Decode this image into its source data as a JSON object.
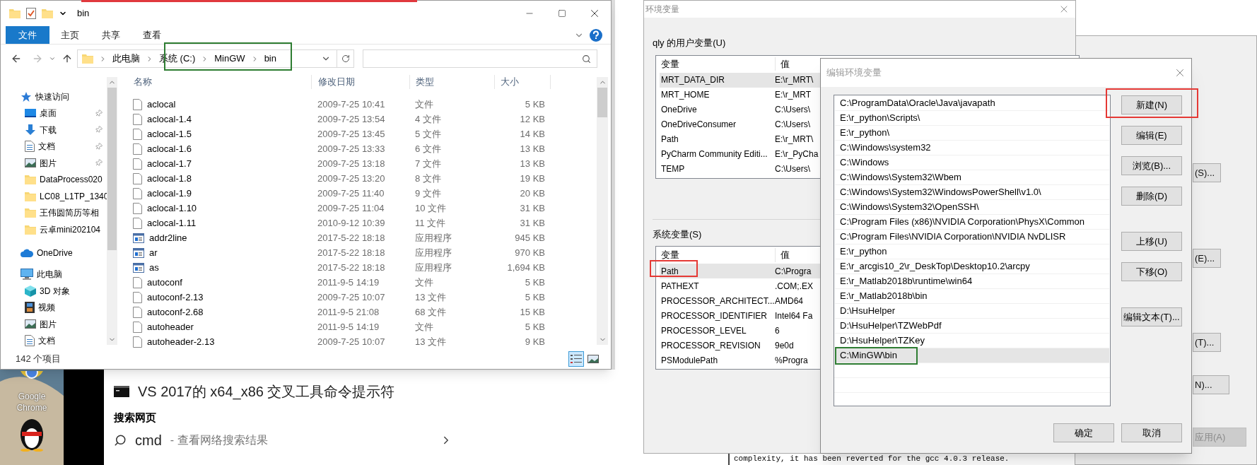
{
  "explorer": {
    "title": "bin",
    "ribbon_tabs": [
      {
        "label": "文件",
        "selected": true
      },
      {
        "label": "主页",
        "selected": false
      },
      {
        "label": "共享",
        "selected": false
      },
      {
        "label": "查看",
        "selected": false
      }
    ],
    "address": [
      "此电脑",
      "系统 (C:)",
      "MinGW",
      "bin"
    ],
    "nav": [
      {
        "label": "快速访问",
        "kind": "quick_access",
        "pinned": false
      },
      {
        "label": "桌面",
        "kind": "desktop",
        "pinned": true
      },
      {
        "label": "下载",
        "kind": "downloads",
        "pinned": true
      },
      {
        "label": "文档",
        "kind": "documents",
        "pinned": true
      },
      {
        "label": "图片",
        "kind": "pictures",
        "pinned": true
      },
      {
        "label": "DataProcess020",
        "kind": "folder",
        "pinned": false
      },
      {
        "label": "LC08_L1TP_1340",
        "kind": "folder",
        "pinned": false
      },
      {
        "label": "王伟圆简历等相",
        "kind": "folder",
        "pinned": false
      },
      {
        "label": "云卓mini202104",
        "kind": "folder",
        "pinned": false
      },
      {
        "label": "OneDrive",
        "kind": "onedrive",
        "pinned": false
      },
      {
        "label": "此电脑",
        "kind": "this_pc",
        "pinned": false
      },
      {
        "label": "3D 对象",
        "kind": "objects3d",
        "pinned": false
      },
      {
        "label": "视频",
        "kind": "videos",
        "pinned": false
      },
      {
        "label": "图片",
        "kind": "pictures",
        "pinned": false
      },
      {
        "label": "文档",
        "kind": "documents",
        "pinned": false
      }
    ],
    "columns": [
      "名称",
      "修改日期",
      "类型",
      "大小"
    ],
    "files": [
      {
        "name": "aclocal",
        "date": "2009-7-25 10:41",
        "type": "文件",
        "size": "5 KB",
        "kind": "file"
      },
      {
        "name": "aclocal-1.4",
        "date": "2009-7-25 13:54",
        "type": "4 文件",
        "size": "12 KB",
        "kind": "file"
      },
      {
        "name": "aclocal-1.5",
        "date": "2009-7-25 13:45",
        "type": "5 文件",
        "size": "14 KB",
        "kind": "file"
      },
      {
        "name": "aclocal-1.6",
        "date": "2009-7-25 13:33",
        "type": "6 文件",
        "size": "13 KB",
        "kind": "file"
      },
      {
        "name": "aclocal-1.7",
        "date": "2009-7-25 13:18",
        "type": "7 文件",
        "size": "13 KB",
        "kind": "file"
      },
      {
        "name": "aclocal-1.8",
        "date": "2009-7-25 13:20",
        "type": "8 文件",
        "size": "19 KB",
        "kind": "file"
      },
      {
        "name": "aclocal-1.9",
        "date": "2009-7-25 11:40",
        "type": "9 文件",
        "size": "20 KB",
        "kind": "file"
      },
      {
        "name": "aclocal-1.10",
        "date": "2009-7-25 11:04",
        "type": "10 文件",
        "size": "31 KB",
        "kind": "file"
      },
      {
        "name": "aclocal-1.11",
        "date": "2010-9-12 10:39",
        "type": "11 文件",
        "size": "31 KB",
        "kind": "file"
      },
      {
        "name": "addr2line",
        "date": "2017-5-22 18:18",
        "type": "应用程序",
        "size": "945 KB",
        "kind": "app"
      },
      {
        "name": "ar",
        "date": "2017-5-22 18:18",
        "type": "应用程序",
        "size": "970 KB",
        "kind": "app"
      },
      {
        "name": "as",
        "date": "2017-5-22 18:18",
        "type": "应用程序",
        "size": "1,694 KB",
        "kind": "app"
      },
      {
        "name": "autoconf",
        "date": "2011-9-5 14:19",
        "type": "文件",
        "size": "5 KB",
        "kind": "file"
      },
      {
        "name": "autoconf-2.13",
        "date": "2009-7-25 10:07",
        "type": "13 文件",
        "size": "5 KB",
        "kind": "file"
      },
      {
        "name": "autoconf-2.68",
        "date": "2011-9-5 21:08",
        "type": "68 文件",
        "size": "15 KB",
        "kind": "file"
      },
      {
        "name": "autoheader",
        "date": "2011-9-5 14:19",
        "type": "文件",
        "size": "5 KB",
        "kind": "file"
      },
      {
        "name": "autoheader-2.13",
        "date": "2009-7-25 10:07",
        "type": "13 文件",
        "size": "9 KB",
        "kind": "file"
      }
    ],
    "status": "142 个项目"
  },
  "desktop_icons": [
    {
      "label": "Google Chrome",
      "kind": "browser"
    },
    {
      "kind": "penguin"
    }
  ],
  "start_panel": {
    "app": "VS 2017的 x64_x86 交叉工具命令提示符",
    "section": "搜索网页",
    "query": "cmd",
    "query_hint": "- 查看网络搜索结果"
  },
  "env_dialog": {
    "title": "环境变量",
    "user_group": "qly 的用户变量(U)",
    "user_columns": [
      "变量",
      "值"
    ],
    "user_vars": [
      {
        "name": "MRT_DATA_DIR",
        "value": "E:\\r_MRT\\",
        "selected": true
      },
      {
        "name": "MRT_HOME",
        "value": "E:\\r_MRT",
        "selected": false
      },
      {
        "name": "OneDrive",
        "value": "C:\\Users\\",
        "selected": false
      },
      {
        "name": "OneDriveConsumer",
        "value": "C:\\Users\\",
        "selected": false
      },
      {
        "name": "Path",
        "value": "E:\\r_MRT\\",
        "selected": false
      },
      {
        "name": "PyCharm Community Editi...",
        "value": "E:\\r_PyCha",
        "selected": false
      },
      {
        "name": "TEMP",
        "value": "C:\\Users\\",
        "selected": false
      }
    ],
    "system_group": "系统变量(S)",
    "system_columns": [
      "变量",
      "值"
    ],
    "system_vars": [
      {
        "name": "Path",
        "value": "C:\\Progra",
        "selected": true
      },
      {
        "name": "PATHEXT",
        "value": ".COM;.EX",
        "selected": false
      },
      {
        "name": "PROCESSOR_ARCHITECT...",
        "value": "AMD64",
        "selected": false
      },
      {
        "name": "PROCESSOR_IDENTIFIER",
        "value": "Intel64 Fa",
        "selected": false
      },
      {
        "name": "PROCESSOR_LEVEL",
        "value": "6",
        "selected": false
      },
      {
        "name": "PROCESSOR_REVISION",
        "value": "9e0d",
        "selected": false
      },
      {
        "name": "PSModulePath",
        "value": "%Progra",
        "selected": false
      }
    ]
  },
  "edit_dialog": {
    "title": "编辑环境变量",
    "paths": [
      {
        "text": "C:\\ProgramData\\Oracle\\Java\\javapath",
        "selected": false
      },
      {
        "text": "E:\\r_python\\Scripts\\",
        "selected": false
      },
      {
        "text": "E:\\r_python\\",
        "selected": false
      },
      {
        "text": "C:\\Windows\\system32",
        "selected": false
      },
      {
        "text": "C:\\Windows",
        "selected": false
      },
      {
        "text": "C:\\Windows\\System32\\Wbem",
        "selected": false
      },
      {
        "text": "C:\\Windows\\System32\\WindowsPowerShell\\v1.0\\",
        "selected": false
      },
      {
        "text": "C:\\Windows\\System32\\OpenSSH\\",
        "selected": false
      },
      {
        "text": "C:\\Program Files (x86)\\NVIDIA Corporation\\PhysX\\Common",
        "selected": false
      },
      {
        "text": "C:\\Program Files\\NVIDIA Corporation\\NVIDIA NvDLISR",
        "selected": false
      },
      {
        "text": "E:\\r_python",
        "selected": false
      },
      {
        "text": "E:\\r_arcgis10_2\\r_DeskTop\\Desktop10.2\\arcpy",
        "selected": false
      },
      {
        "text": "E:\\r_Matlab2018b\\runtime\\win64",
        "selected": false
      },
      {
        "text": "E:\\r_Matlab2018b\\bin",
        "selected": false
      },
      {
        "text": "D:\\HsuHelper",
        "selected": false
      },
      {
        "text": "D:\\HsuHelper\\TZWebPdf",
        "selected": false
      },
      {
        "text": "D:\\HsuHelper\\TZKey",
        "selected": false
      },
      {
        "text": "C:\\MinGW\\bin",
        "selected": true
      }
    ],
    "buttons": [
      "新建(N)",
      "编辑(E)",
      "浏览(B)...",
      "删除(D)",
      "上移(U)",
      "下移(O)",
      "编辑文本(T)..."
    ],
    "ok": "确定",
    "cancel": "取消"
  },
  "system_props": {
    "buttons": [
      {
        "label": "(S)...",
        "disabled": false
      },
      {
        "label": "(E)...",
        "disabled": false
      },
      {
        "label": "(T)...",
        "disabled": false
      },
      {
        "label": "N)...",
        "disabled": false
      },
      {
        "label": "应用(A)",
        "disabled": true
      }
    ]
  },
  "terminal_line": "complexity, it has been reverted for the gcc 4.0.3 release."
}
